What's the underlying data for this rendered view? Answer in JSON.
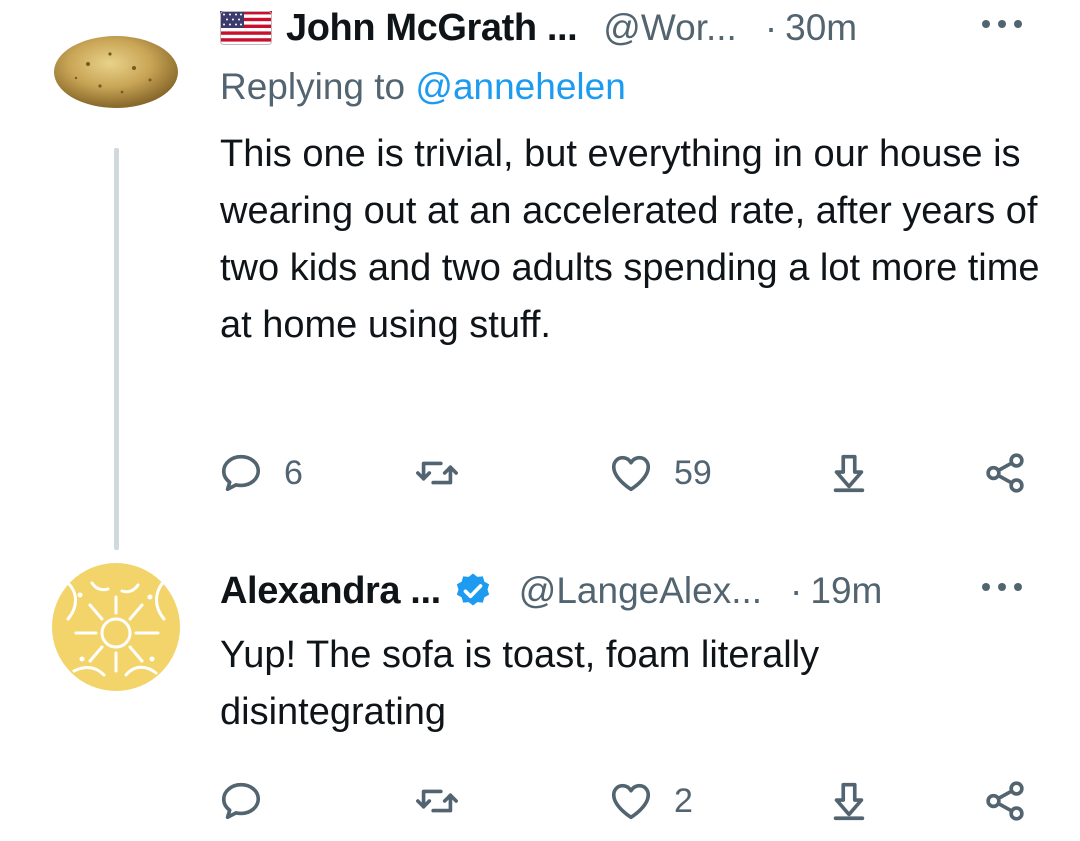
{
  "tweets": [
    {
      "author_name": "John McGrath ...",
      "handle": "@Wor...",
      "dot": "·",
      "time": "30m",
      "replying_prefix": "Replying to",
      "replying_to": "@annehelen",
      "text": "This one is trivial, but everything in our house is wearing out at an accelerated rate, after years of two kids and two adults spending a lot more time at home using stuff.",
      "reply_count": "6",
      "retweet_count": "",
      "like_count": "59",
      "avatar_icon": "potato-avatar",
      "name_icon": "us-flag-icon"
    },
    {
      "author_name": "Alexandra ...",
      "handle": "@LangeAlex...",
      "dot": "·",
      "time": "19m",
      "text": "Yup! The sofa is toast, foam literally disintegrating",
      "reply_count": "",
      "retweet_count": "",
      "like_count": "2",
      "avatar_icon": "yellow-pattern-avatar",
      "name_icon": "verified-badge-icon"
    }
  ],
  "colors": {
    "text": "#0f1419",
    "muted": "#536471",
    "link": "#1d9bf0",
    "thread_line": "#cfd9de"
  }
}
